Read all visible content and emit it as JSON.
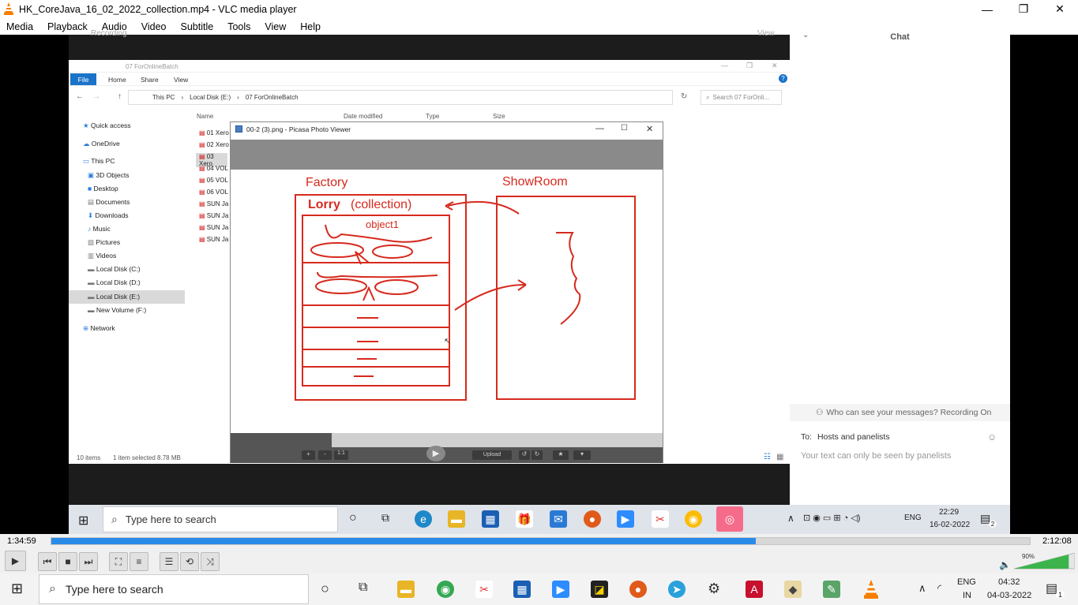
{
  "window": {
    "title": "HK_CoreJava_16_02_2022_collection.mp4 - VLC media player",
    "minimize": "—",
    "maximize": "❐",
    "close": "✕"
  },
  "menu": [
    "Media",
    "Playback",
    "Audio",
    "Video",
    "Subtitle",
    "Tools",
    "View",
    "Help"
  ],
  "video": {
    "recording_label": "Recording",
    "view_label": "View",
    "chat": {
      "title": "Chat",
      "who_can_see": "Who can see your messages? Recording On",
      "to_label": "To:",
      "to_value": "Hosts and panelists",
      "input_placeholder": "Your text can only be seen by panelists"
    },
    "explorer": {
      "title": "07 ForOnlineBatch",
      "ribbon_tabs": [
        "File",
        "Home",
        "Share",
        "View"
      ],
      "path": [
        "This PC",
        "Local Disk (E:)",
        "07 ForOnlineBatch"
      ],
      "search_placeholder": "Search 07 ForOnli...",
      "columns": [
        "Name",
        "Date modified",
        "Type",
        "Size"
      ],
      "nav": [
        "Quick access",
        "OneDrive",
        "This PC",
        "3D Objects",
        "Desktop",
        "Documents",
        "Downloads",
        "Music",
        "Pictures",
        "Videos",
        "Local Disk (C:)",
        "Local Disk (D:)",
        "Local Disk (E:)",
        "New Volume (F:)",
        "Network"
      ],
      "files": [
        "01 Xero",
        "02 Xero",
        "03 Xero",
        "04 VOL",
        "05 VOL",
        "06 VOL",
        "SUN Ja",
        "SUN Ja",
        "SUN Ja",
        "SUN Ja"
      ],
      "status_items": "10 items",
      "status_selected": "1 item selected  8.78 MB"
    },
    "picasa": {
      "title": "00-2 (3).png - Picasa Photo Viewer",
      "upload": "Upload",
      "zoom_1_1": "1:1"
    },
    "whiteboard": {
      "factory": "Factory",
      "showroom": "ShowRoom",
      "lorry": "Lorry",
      "collection": "(collection)",
      "object1": "object1"
    },
    "inner_taskbar": {
      "search_placeholder": "Type here to search",
      "lang": "ENG",
      "time": "22:29",
      "date": "16-02-2022",
      "notif_count": "2"
    }
  },
  "player": {
    "elapsed": "1:34:59",
    "total": "2:12:08",
    "progress": 0.72,
    "volume_label": "90%",
    "volume": 0.9
  },
  "taskbar": {
    "search_placeholder": "Type here to search",
    "lang_top": "ENG",
    "lang_bottom": "IN",
    "time": "04:32",
    "date": "04-03-2022",
    "notif_count": "1"
  }
}
